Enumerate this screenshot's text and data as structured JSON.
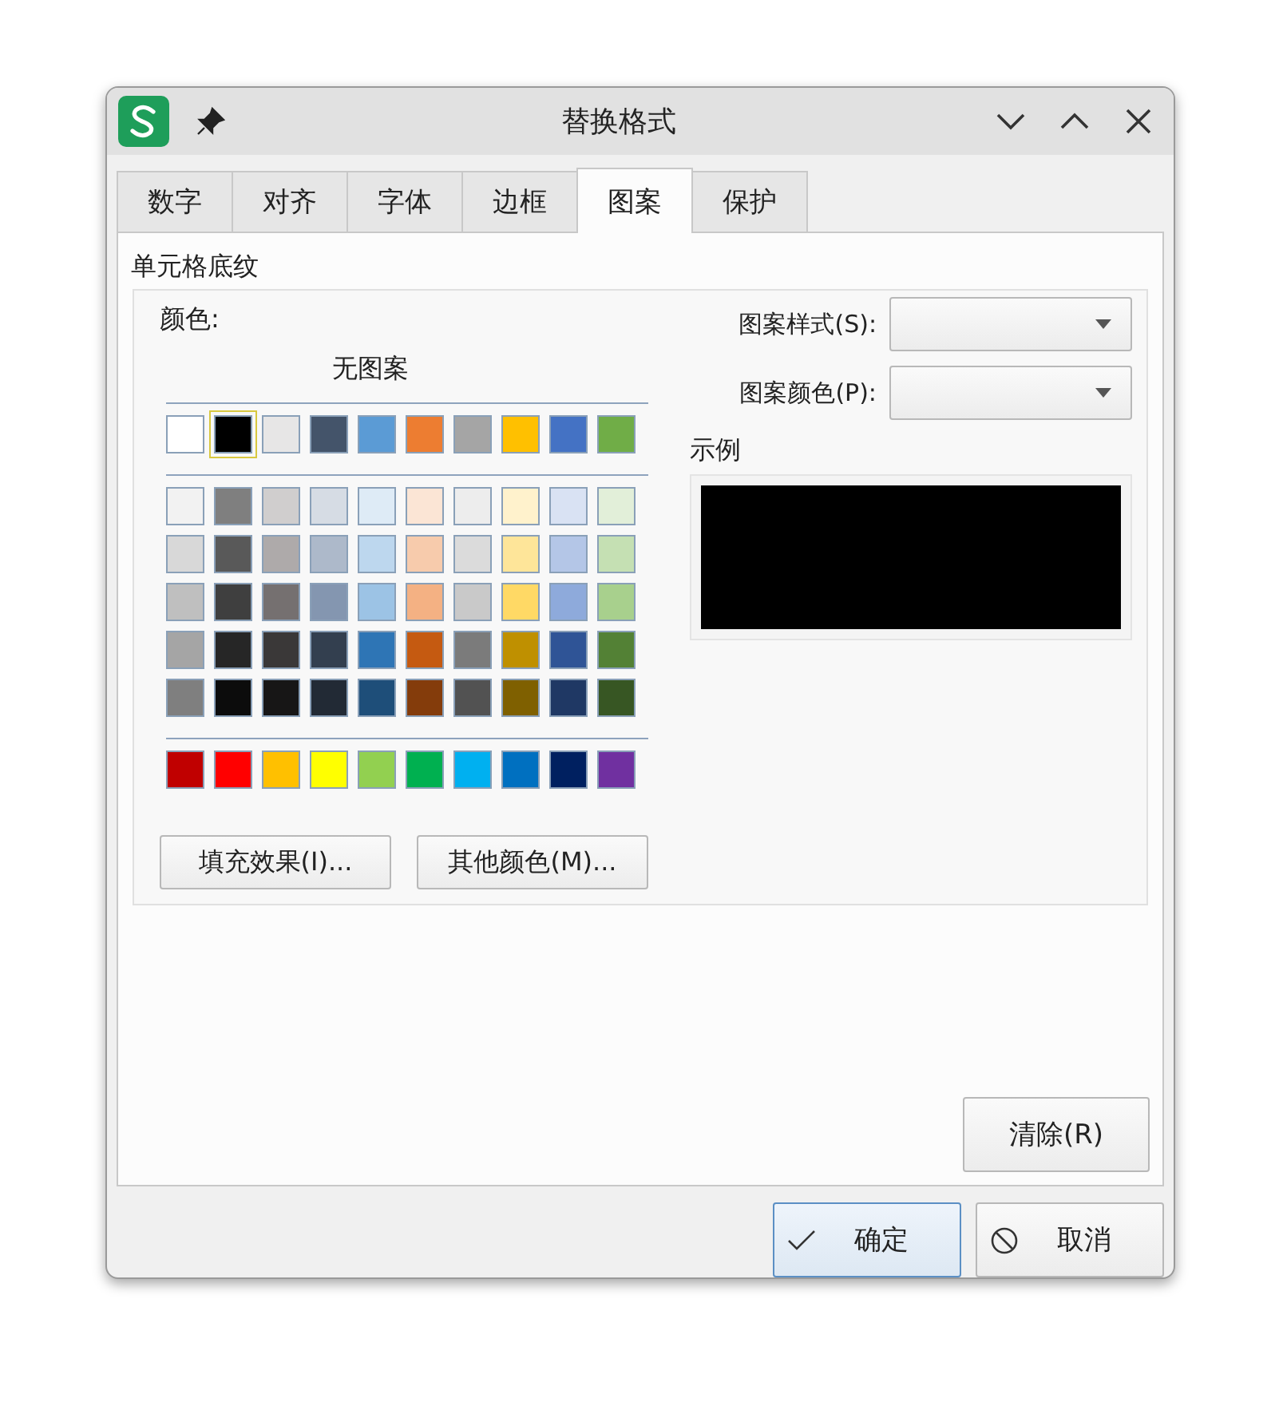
{
  "window": {
    "title": "替换格式"
  },
  "tabs": [
    {
      "label": "数字",
      "selected": false
    },
    {
      "label": "对齐",
      "selected": false
    },
    {
      "label": "字体",
      "selected": false
    },
    {
      "label": "边框",
      "selected": false
    },
    {
      "label": "图案",
      "selected": true
    },
    {
      "label": "保护",
      "selected": false
    }
  ],
  "group_title": "单元格底纹",
  "color_label": "颜色:",
  "no_pattern": "无图案",
  "palette": {
    "theme": [
      {
        "color": "#ffffff",
        "selected": false
      },
      {
        "color": "#000000",
        "selected": true
      },
      {
        "color": "#e7e6e6",
        "selected": false
      },
      {
        "color": "#44546a",
        "selected": false
      },
      {
        "color": "#5b9bd5",
        "selected": false
      },
      {
        "color": "#ed7d31",
        "selected": false
      },
      {
        "color": "#a5a5a5",
        "selected": false
      },
      {
        "color": "#ffc000",
        "selected": false
      },
      {
        "color": "#4472c4",
        "selected": false
      },
      {
        "color": "#70ad47",
        "selected": false
      }
    ],
    "shades": [
      [
        {
          "color": "#f2f2f2",
          "selected": false
        },
        {
          "color": "#7f7f7f",
          "selected": false
        },
        {
          "color": "#d0cece",
          "selected": false
        },
        {
          "color": "#d6dce4",
          "selected": false
        },
        {
          "color": "#deebf6",
          "selected": false
        },
        {
          "color": "#fbe5d5",
          "selected": false
        },
        {
          "color": "#ededed",
          "selected": false
        },
        {
          "color": "#fff2cc",
          "selected": false
        },
        {
          "color": "#d9e2f3",
          "selected": false
        },
        {
          "color": "#e2efd9",
          "selected": false
        }
      ],
      [
        {
          "color": "#d8d8d8",
          "selected": false
        },
        {
          "color": "#595959",
          "selected": false
        },
        {
          "color": "#aeaaaa",
          "selected": false
        },
        {
          "color": "#adb9ca",
          "selected": false
        },
        {
          "color": "#bdd7ee",
          "selected": false
        },
        {
          "color": "#f7cbac",
          "selected": false
        },
        {
          "color": "#dbdbdb",
          "selected": false
        },
        {
          "color": "#fee599",
          "selected": false
        },
        {
          "color": "#b4c6e7",
          "selected": false
        },
        {
          "color": "#c5e0b3",
          "selected": false
        }
      ],
      [
        {
          "color": "#bfbfbf",
          "selected": false
        },
        {
          "color": "#3f3f3f",
          "selected": false
        },
        {
          "color": "#757070",
          "selected": false
        },
        {
          "color": "#8496b0",
          "selected": false
        },
        {
          "color": "#9cc3e5",
          "selected": false
        },
        {
          "color": "#f4b183",
          "selected": false
        },
        {
          "color": "#c9c9c9",
          "selected": false
        },
        {
          "color": "#ffd965",
          "selected": false
        },
        {
          "color": "#8eaadb",
          "selected": false
        },
        {
          "color": "#a8d08d",
          "selected": false
        }
      ],
      [
        {
          "color": "#a5a5a5",
          "selected": false
        },
        {
          "color": "#262626",
          "selected": false
        },
        {
          "color": "#3a3838",
          "selected": false
        },
        {
          "color": "#333f4f",
          "selected": false
        },
        {
          "color": "#2e75b5",
          "selected": false
        },
        {
          "color": "#c55a11",
          "selected": false
        },
        {
          "color": "#7b7b7b",
          "selected": false
        },
        {
          "color": "#bf9000",
          "selected": false
        },
        {
          "color": "#2f5496",
          "selected": false
        },
        {
          "color": "#538135",
          "selected": false
        }
      ],
      [
        {
          "color": "#7f7f7f",
          "selected": false
        },
        {
          "color": "#0c0c0c",
          "selected": false
        },
        {
          "color": "#171616",
          "selected": false
        },
        {
          "color": "#222a35",
          "selected": false
        },
        {
          "color": "#1e4e79",
          "selected": false
        },
        {
          "color": "#843c0b",
          "selected": false
        },
        {
          "color": "#525252",
          "selected": false
        },
        {
          "color": "#7f6000",
          "selected": false
        },
        {
          "color": "#1f3864",
          "selected": false
        },
        {
          "color": "#375623",
          "selected": false
        }
      ]
    ],
    "standard": [
      {
        "color": "#c00000",
        "selected": false
      },
      {
        "color": "#ff0000",
        "selected": false
      },
      {
        "color": "#ffc000",
        "selected": false
      },
      {
        "color": "#ffff00",
        "selected": false
      },
      {
        "color": "#92d050",
        "selected": false
      },
      {
        "color": "#00b050",
        "selected": false
      },
      {
        "color": "#00b0f0",
        "selected": false
      },
      {
        "color": "#0070c0",
        "selected": false
      },
      {
        "color": "#002060",
        "selected": false
      },
      {
        "color": "#7030a0",
        "selected": false
      }
    ]
  },
  "fill_effects_button": "填充效果(I)...",
  "more_colors_button": "其他颜色(M)...",
  "pattern_style": {
    "label": "图案样式(S):"
  },
  "pattern_color": {
    "label": "图案颜色(P):"
  },
  "sample": {
    "label": "示例",
    "color": "#000000"
  },
  "clear_button": "清除(R)",
  "buttons": [
    {
      "kind": "ok",
      "label": "确定"
    },
    {
      "kind": "cancel",
      "label": "取消"
    }
  ]
}
